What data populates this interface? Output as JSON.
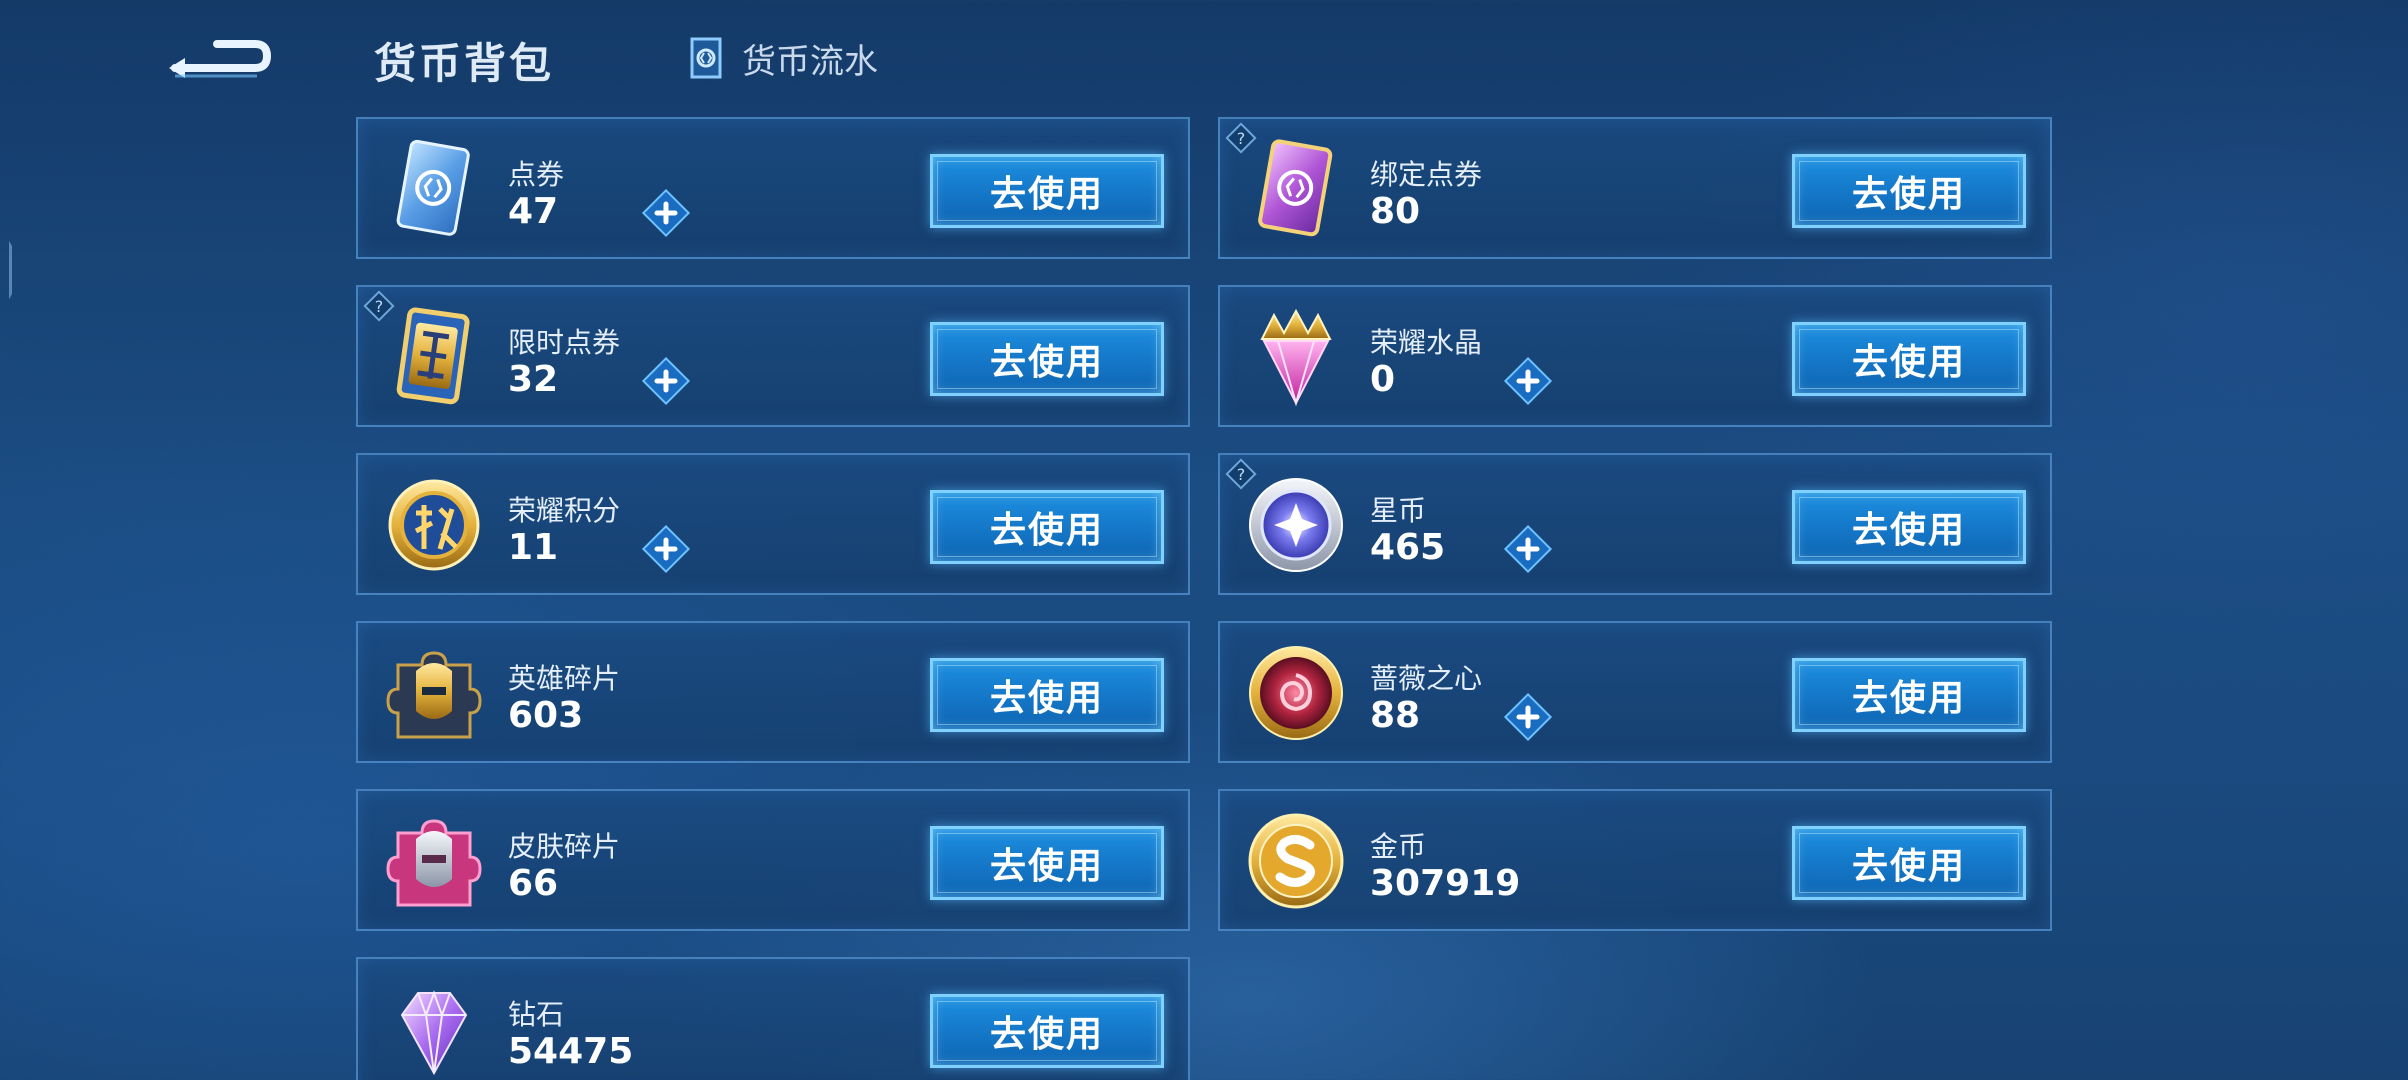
{
  "header": {
    "back_icon": "back-arrow-icon",
    "title": "货币背包",
    "flow_tab_icon": "ledger-icon",
    "flow_tab_label": "货币流水"
  },
  "currencies": [
    {
      "name": "点券",
      "value": "47",
      "icon": "voucher-icon",
      "has_plus": true,
      "has_help": false,
      "button": "去使用"
    },
    {
      "name": "绑定点券",
      "value": "80",
      "icon": "bound-voucher-icon",
      "has_plus": false,
      "has_help": true,
      "button": "去使用"
    },
    {
      "name": "限时点券",
      "value": "32",
      "icon": "limited-voucher-icon",
      "has_plus": true,
      "has_help": true,
      "button": "去使用"
    },
    {
      "name": "荣耀水晶",
      "value": "0",
      "icon": "glory-crystal-icon",
      "has_plus": true,
      "has_help": false,
      "button": "去使用"
    },
    {
      "name": "荣耀积分",
      "value": "11",
      "icon": "glory-points-icon",
      "has_plus": true,
      "has_help": false,
      "button": "去使用"
    },
    {
      "name": "星币",
      "value": "465",
      "icon": "star-coin-icon",
      "has_plus": true,
      "has_help": true,
      "button": "去使用"
    },
    {
      "name": "英雄碎片",
      "value": "603",
      "icon": "hero-fragment-icon",
      "has_plus": false,
      "has_help": false,
      "button": "去使用"
    },
    {
      "name": "蔷薇之心",
      "value": "88",
      "icon": "rose-heart-icon",
      "has_plus": true,
      "has_help": false,
      "button": "去使用"
    },
    {
      "name": "皮肤碎片",
      "value": "66",
      "icon": "skin-fragment-icon",
      "has_plus": false,
      "has_help": false,
      "button": "去使用"
    },
    {
      "name": "金币",
      "value": "307919",
      "icon": "gold-coin-icon",
      "has_plus": false,
      "has_help": false,
      "button": "去使用"
    },
    {
      "name": "钻石",
      "value": "54475",
      "icon": "diamond-icon",
      "has_plus": false,
      "has_help": false,
      "button": "去使用"
    }
  ],
  "colors": {
    "background": "#1b4c82",
    "card_border": "#5696d4",
    "button_fill": "#1578c9",
    "button_border": "#7fd2ff"
  }
}
